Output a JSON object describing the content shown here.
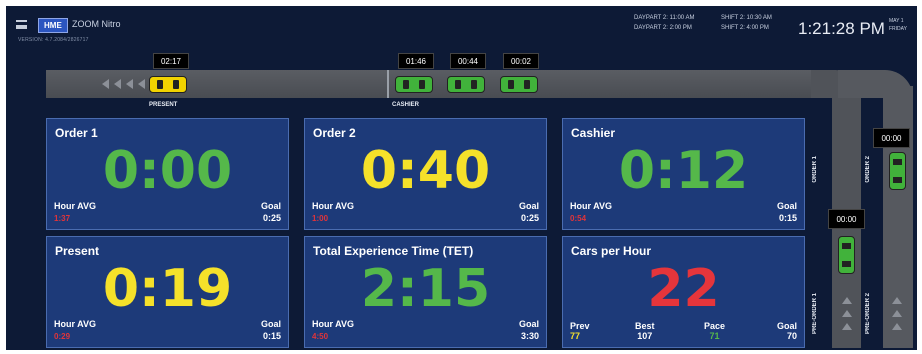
{
  "header": {
    "logo": "HME",
    "app_name": "ZOOM Nitro",
    "version": "VERSION: 4.7.2084/2826717",
    "daypart_line1": "DAYPART 2: 11:00 AM",
    "daypart_line2": "DAYPART 2: 2:00 PM",
    "shift_line1": "SHIFT 2: 10:30 AM",
    "shift_line2": "SHIFT 2: 4:00 PM",
    "clock": "1:21:28 PM",
    "date_line1": "MAY 1",
    "date_line2": "FRIDAY"
  },
  "lane": {
    "present_timer": "02:17",
    "present_label": "PRESENT",
    "cashier_timers": [
      "01:46",
      "00:44",
      "00:02"
    ],
    "cashier_label": "CASHIER"
  },
  "right_lanes": {
    "order1_label": "ORDER 1",
    "order2_label": "ORDER 2",
    "preorder1_label": "PRE-ORDER 1",
    "preorder2_label": "PRE-ORDER 2",
    "order1_timer": "00:00",
    "order2_timer": "00:00"
  },
  "panels": {
    "order1": {
      "title": "Order 1",
      "value": "0:00",
      "hour_avg_label": "Hour AVG",
      "hour_avg": "1:37",
      "goal_label": "Goal",
      "goal": "0:25"
    },
    "order2": {
      "title": "Order 2",
      "value": "0:40",
      "hour_avg_label": "Hour AVG",
      "hour_avg": "1:00",
      "goal_label": "Goal",
      "goal": "0:25"
    },
    "cashier": {
      "title": "Cashier",
      "value": "0:12",
      "hour_avg_label": "Hour AVG",
      "hour_avg": "0:54",
      "goal_label": "Goal",
      "goal": "0:15"
    },
    "present": {
      "title": "Present",
      "value": "0:19",
      "hour_avg_label": "Hour AVG",
      "hour_avg": "0:29",
      "goal_label": "Goal",
      "goal": "0:15"
    },
    "tet": {
      "title": "Total Experience Time (TET)",
      "value": "2:15",
      "hour_avg_label": "Hour AVG",
      "hour_avg": "4:50",
      "goal_label": "Goal",
      "goal": "3:30"
    },
    "cph": {
      "title": "Cars per Hour",
      "value": "22",
      "prev_label": "Prev",
      "prev": "77",
      "best_label": "Best",
      "best": "107",
      "pace_label": "Pace",
      "pace": "71",
      "goal_label": "Goal",
      "goal": "70"
    }
  },
  "colors": {
    "background": "#0d1a36",
    "panel": "#1d3a79",
    "good": "#55b84a",
    "warn": "#f5e12a",
    "bad": "#e5353b"
  }
}
